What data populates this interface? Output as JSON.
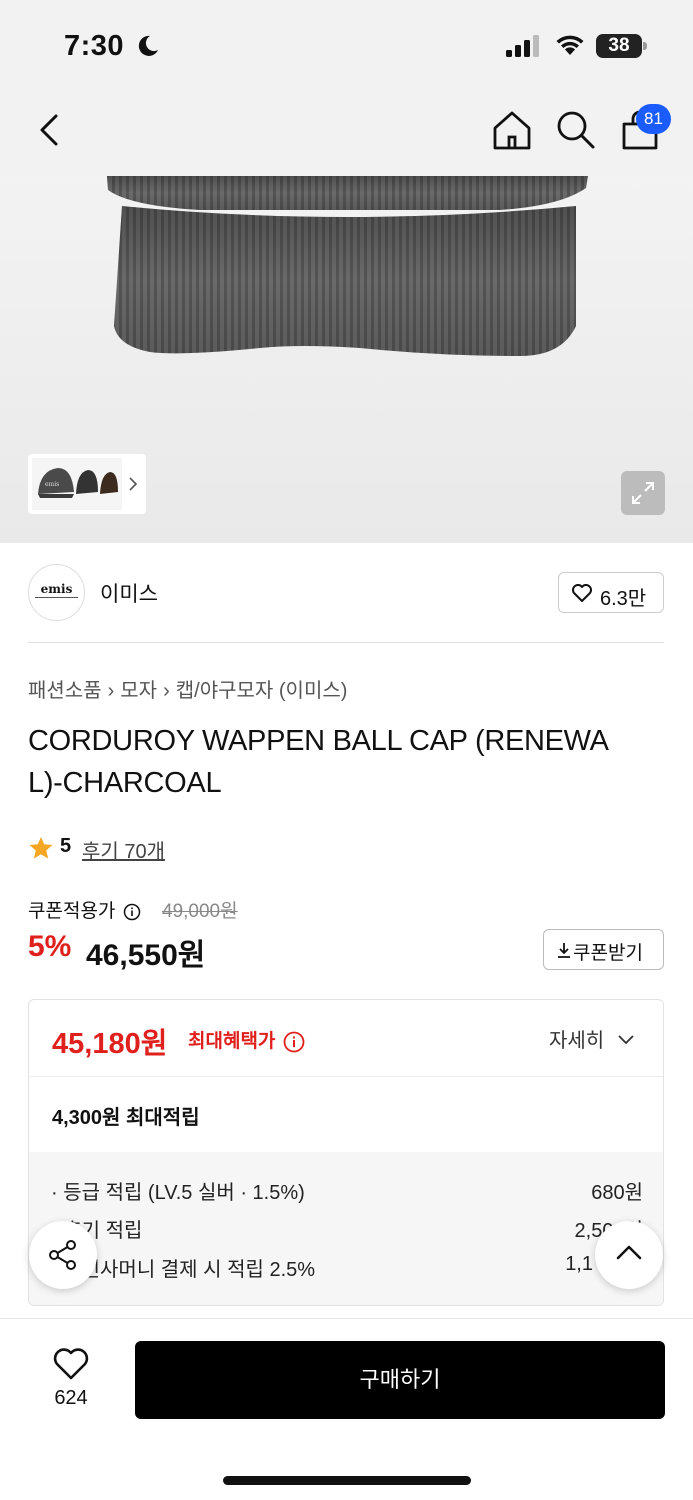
{
  "status_bar": {
    "time": "7:30",
    "battery": "38"
  },
  "nav": {
    "cart_count": "81",
    "icons": [
      "chevron-left-icon",
      "home-icon",
      "search-icon",
      "shopping-bag-icon"
    ]
  },
  "gallery": {
    "thumbnail_logo": "emis"
  },
  "brand": {
    "logo_text": "emis",
    "name": "이미스",
    "likes": "6.3만"
  },
  "breadcrumb": [
    "패션소품",
    "모자",
    "캡/야구모자 (이미스)"
  ],
  "product": {
    "title_line1": "CORDUROY WAPPEN BALL CAP (RENEWA",
    "title_line2": "L)-CHARCOAL",
    "rating": "5",
    "reviews": "후기 70개"
  },
  "price": {
    "coupon_label": "쿠폰적용가",
    "original": "49,000원",
    "discount": "5%",
    "final": "46,550원",
    "coupon_button": "쿠폰받기"
  },
  "benefit": {
    "max_price": "45,180원",
    "max_label": "최대혜택가",
    "detail_button": "자세히",
    "max_points": "4,300원 최대적립",
    "points": [
      {
        "label": "· 등급 적립 (LV.5 실버 · 1.5%)",
        "value": "680원"
      },
      {
        "label": "· 후기 적립",
        "value": "2,500원"
      },
      {
        "label": "· 무신사머니 결제 시 적립 2.5%",
        "value": "1,1"
      }
    ]
  },
  "bottom_bar": {
    "wish_count": "624",
    "buy_label": "구매하기"
  },
  "colors": {
    "accent_red": "#e0201c",
    "badge_blue": "#1a5cff",
    "star": "#f5a623"
  }
}
